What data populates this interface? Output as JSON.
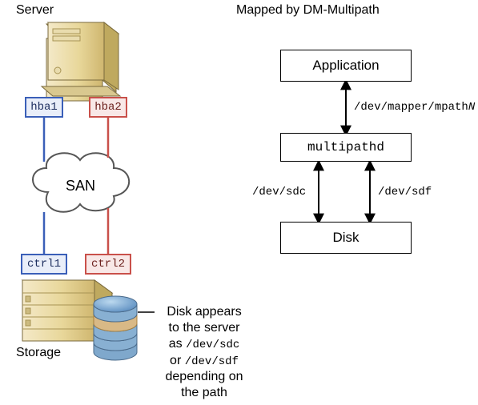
{
  "left": {
    "server_label": "Server",
    "hba1": "hba1",
    "hba2": "hba2",
    "san": "SAN",
    "ctrl1": "ctrl1",
    "ctrl2": "ctrl2",
    "storage_label": "Storage",
    "note_line1": "Disk appears",
    "note_line2": "to the server",
    "note_line3_prefix": "as ",
    "note_path1": "/dev/sdc",
    "note_line4_prefix": "or ",
    "note_path2": "/dev/sdf",
    "note_line5": "depending on",
    "note_line6": "the path"
  },
  "right": {
    "title": "Mapped by DM-Multipath",
    "app_label": "Application",
    "mpath_label": "/dev/mapper/mpath",
    "mpath_suffix": "N",
    "multipathd_label": "multipathd",
    "dev1": "/dev/sdc",
    "dev2": "/dev/sdf",
    "disk_label": "Disk"
  }
}
